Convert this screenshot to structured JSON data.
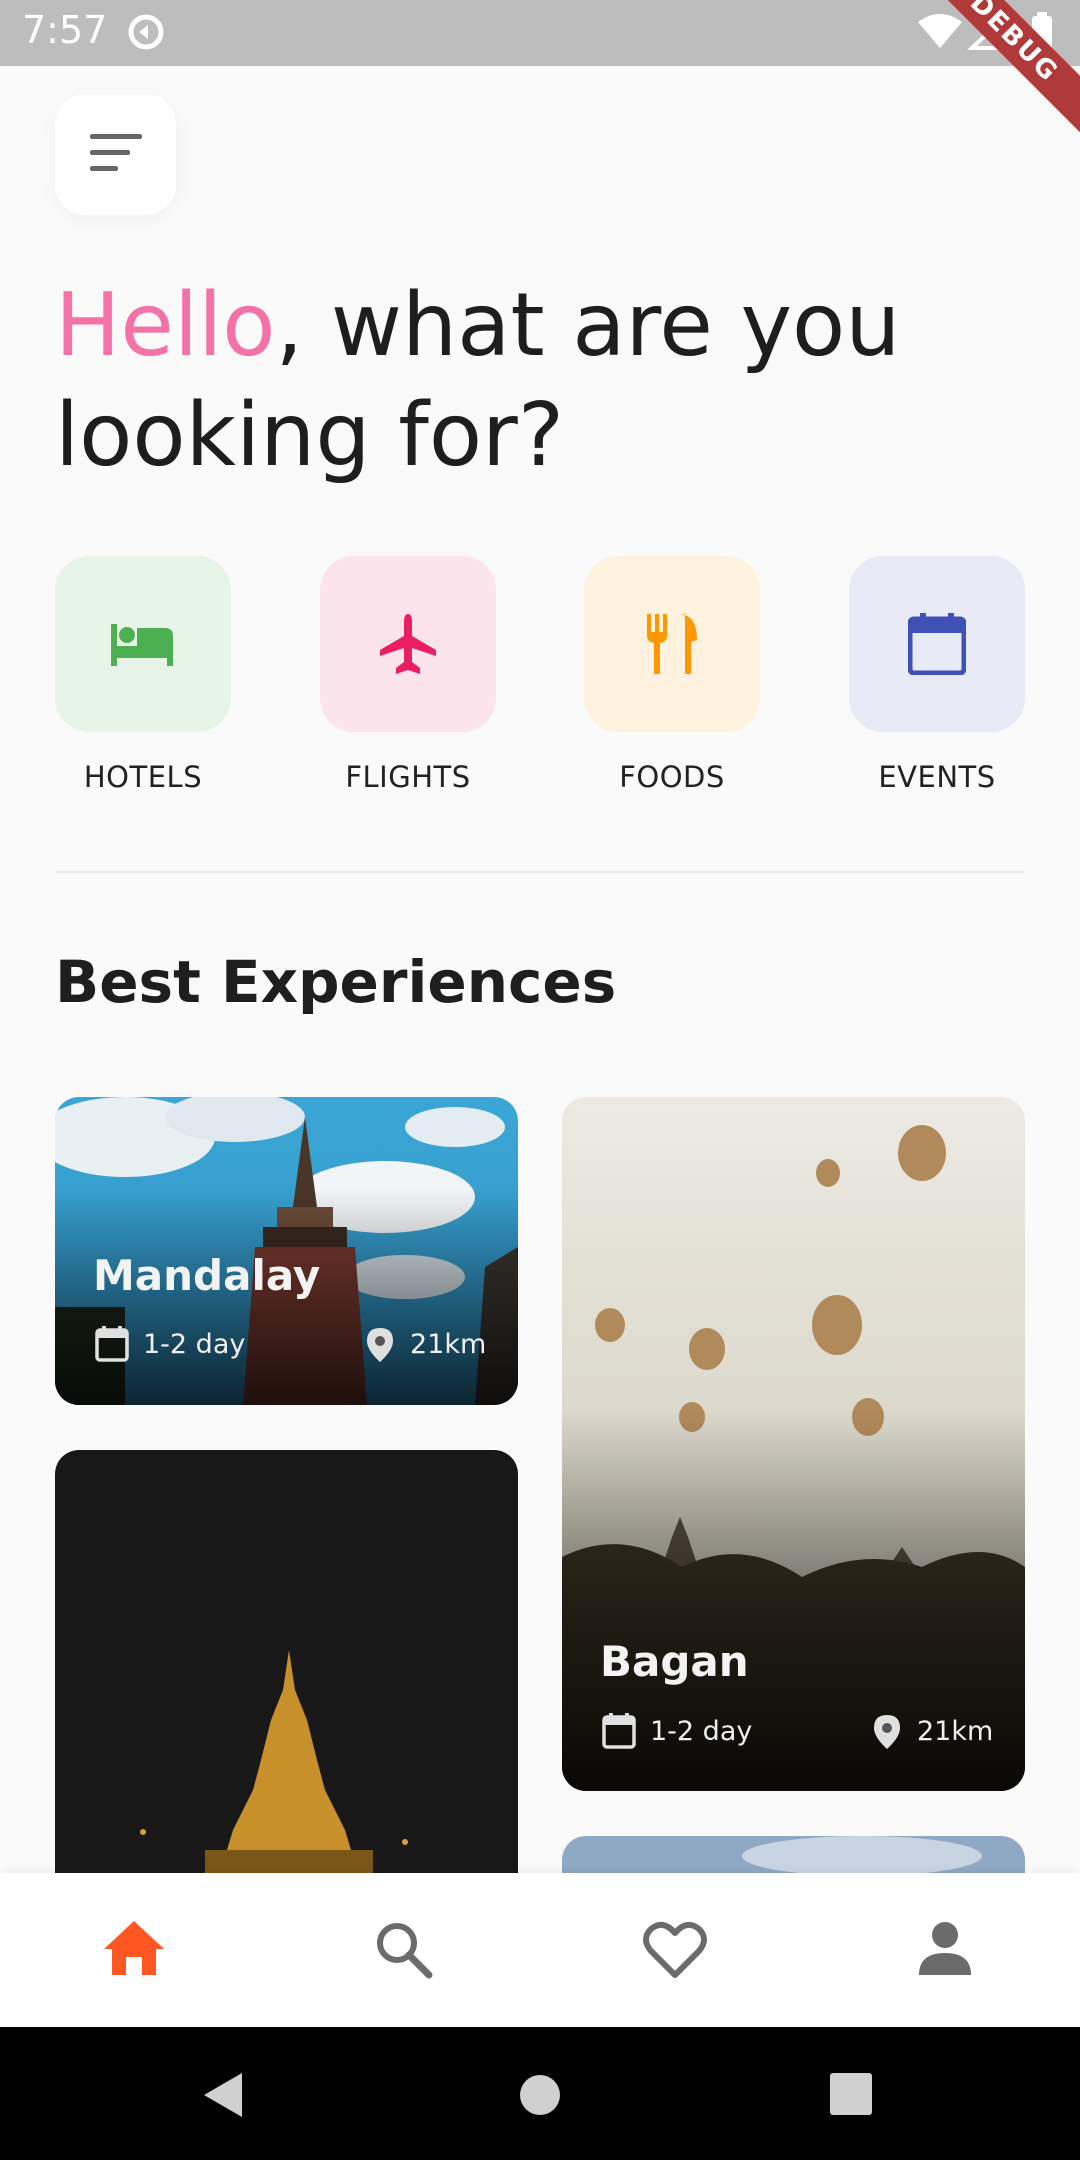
{
  "status_bar": {
    "time": "7:57",
    "debug_label": "DEBUG"
  },
  "header": {
    "menu_icon": "menu-icon"
  },
  "greeting": {
    "highlight": "Hello",
    "rest": ", what are you looking for?",
    "highlight_color": "#f472a8"
  },
  "categories": [
    {
      "label": "HOTELS",
      "icon": "hotel-bed-icon",
      "bg": "#e7f5e8",
      "color": "#4caf50"
    },
    {
      "label": "FLIGHTS",
      "icon": "airplane-icon",
      "bg": "#fce4ec",
      "color": "#e91e63"
    },
    {
      "label": "FOODS",
      "icon": "restaurant-icon",
      "bg": "#fff3e0",
      "color": "#ff9800"
    },
    {
      "label": "EVENTS",
      "icon": "calendar-icon",
      "bg": "#e8eaf6",
      "color": "#3f51b5"
    }
  ],
  "section": {
    "title": "Best Experiences"
  },
  "experiences": [
    {
      "name": "Mandalay",
      "duration": "1-2 day",
      "distance": "21km"
    },
    {
      "name": "Bagan",
      "duration": "1-2 day",
      "distance": "21km"
    }
  ],
  "bottom_nav": [
    {
      "icon": "home-icon",
      "active": true
    },
    {
      "icon": "search-icon",
      "active": false
    },
    {
      "icon": "heart-icon",
      "active": false
    },
    {
      "icon": "profile-icon",
      "active": false
    }
  ],
  "colors": {
    "nav_active": "#ff5722",
    "nav_inactive": "#6b6b6b"
  }
}
